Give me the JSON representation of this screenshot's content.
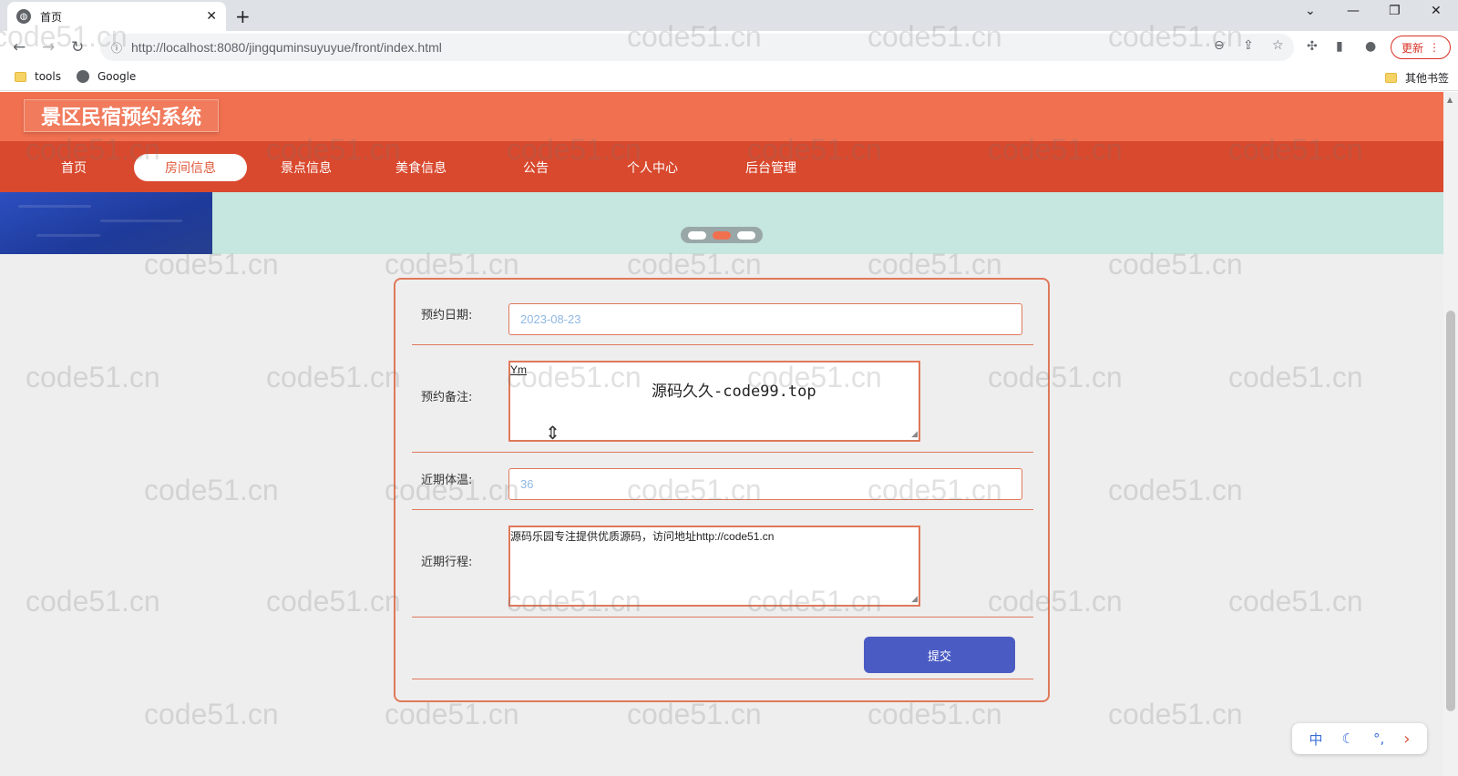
{
  "browser": {
    "tab_title": "首页",
    "url": "http://localhost:8080/jingquminsuyuyue/front/index.html",
    "update_label": "更新",
    "bookmarks": [
      {
        "label": "tools"
      },
      {
        "label": "Google"
      }
    ],
    "other_bookmarks_label": "其他书签"
  },
  "site": {
    "title": "景区民宿预约系统",
    "nav": [
      {
        "label": "首页"
      },
      {
        "label": "房间信息"
      },
      {
        "label": "景点信息"
      },
      {
        "label": "美食信息"
      },
      {
        "label": "公告"
      },
      {
        "label": "个人中心"
      },
      {
        "label": "后台管理"
      }
    ],
    "active_nav": "房间信息",
    "carousel_active_index": 1
  },
  "form": {
    "date_label": "预约日期:",
    "date_value": "2023-08-23",
    "note_label": "预约备注:",
    "note_value": "Ym",
    "temp_label": "近期体温:",
    "temp_value": "36",
    "itinerary_label": "近期行程:",
    "itinerary_value": "源码乐园专注提供优质源码，访问地址http://code51.cn",
    "submit_label": "提交"
  },
  "overlay_text": "源码久久-code99.top",
  "watermark_text": "code51.cn",
  "ime": {
    "mode": "中"
  },
  "colors": {
    "header": "#f07050",
    "nav": "#d9492e",
    "accent_border": "#e0785a",
    "submit": "#4a5bc4"
  }
}
